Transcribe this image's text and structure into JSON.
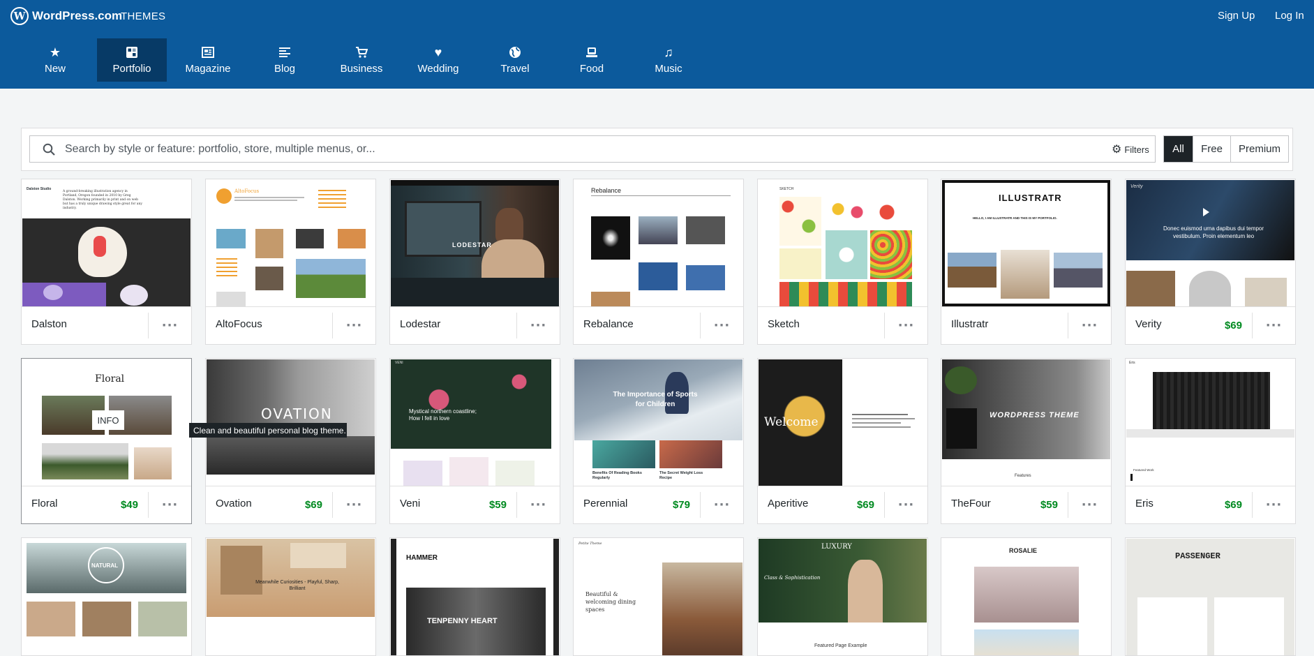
{
  "topbar": {
    "brand": "WordPress.com",
    "section": "THEMES",
    "signup": "Sign Up",
    "login": "Log In"
  },
  "categories": [
    {
      "label": "New",
      "icon": "star-icon"
    },
    {
      "label": "Portfolio",
      "icon": "portfolio-icon",
      "active": true
    },
    {
      "label": "Magazine",
      "icon": "magazine-icon"
    },
    {
      "label": "Blog",
      "icon": "blog-icon"
    },
    {
      "label": "Business",
      "icon": "cart-icon"
    },
    {
      "label": "Wedding",
      "icon": "heart-icon"
    },
    {
      "label": "Travel",
      "icon": "globe-icon"
    },
    {
      "label": "Food",
      "icon": "food-icon"
    },
    {
      "label": "Music",
      "icon": "music-icon"
    }
  ],
  "search": {
    "placeholder": "Search by style or feature: portfolio, store, multiple menus, or...",
    "filters_label": "Filters"
  },
  "price_filter": {
    "options": [
      "All",
      "Free",
      "Premium"
    ],
    "selected": "All"
  },
  "tooltip": "Clean and beautiful personal blog theme.",
  "info_badge": "INFO",
  "colors": {
    "header": "#0c5a9c",
    "active_tab": "#073a66",
    "price": "#008a20"
  },
  "themes": [
    {
      "name": "Dalston",
      "price": ""
    },
    {
      "name": "AltoFocus",
      "price": ""
    },
    {
      "name": "Lodestar",
      "price": ""
    },
    {
      "name": "Rebalance",
      "price": ""
    },
    {
      "name": "Sketch",
      "price": ""
    },
    {
      "name": "Illustratr",
      "price": ""
    },
    {
      "name": "Verity",
      "price": "$69"
    },
    {
      "name": "Floral",
      "price": "$49"
    },
    {
      "name": "Ovation",
      "price": "$69"
    },
    {
      "name": "Veni",
      "price": "$59"
    },
    {
      "name": "Perennial",
      "price": "$79"
    },
    {
      "name": "Aperitive",
      "price": "$69"
    },
    {
      "name": "TheFour",
      "price": "$59"
    },
    {
      "name": "Eris",
      "price": "$69"
    }
  ],
  "previews": {
    "dalston": "A ground-breaking illustration agency in Portland, Oregon founded in 2010 by Greg Dalston. Working primarily in print and on web but has a truly unique drawing style great for any industry.",
    "dalston_site": "Dalston Studio",
    "altofocus": "AltoFocus",
    "lodestar": "LODESTAR",
    "rebalance": "Rebalance",
    "sketch": "SKETCH",
    "illustratr": "ILLUSTRATR",
    "illustratr_sub": "HELLO, I AM ILLUSTRATR AND THIS IS MY PORTFOLIO.",
    "verity_site": "Verity",
    "verity_text": "Donec euismod urna dapibus dui tempor vestibulum. Proin elementum leo",
    "floral": "Floral",
    "ovation": "OVATION",
    "veni_site": "VENI",
    "veni_text": "Mystical northern coastline; How I fell in love",
    "perennial_text": "The Importance of Sports for Children",
    "perennial_a": "Benefits Of Reading Books Regularly",
    "perennial_b": "The Secret Weight Loss Recipe",
    "aperitive": "Welcome",
    "thefour": "WORDPRESS THEME",
    "thefour_features": "Features",
    "eris_site": "Eris",
    "eris_label": "Featured Work",
    "natural": "NATURAL",
    "meanwhile": "Meanwhile Curiosities - Playful, Sharp, Brilliant",
    "hammer": "HAMMER",
    "hammer_hero": "TENPENNY HEART",
    "petite": "Petite Theme",
    "petite_text": "Beautiful & welcoming dining spaces",
    "luxury": "LUXURY",
    "luxury_sub": "Class & Sophistication",
    "luxury_foot": "Featured Page Example",
    "rosalie": "ROSALIE",
    "passenger": "PASSENGER"
  }
}
